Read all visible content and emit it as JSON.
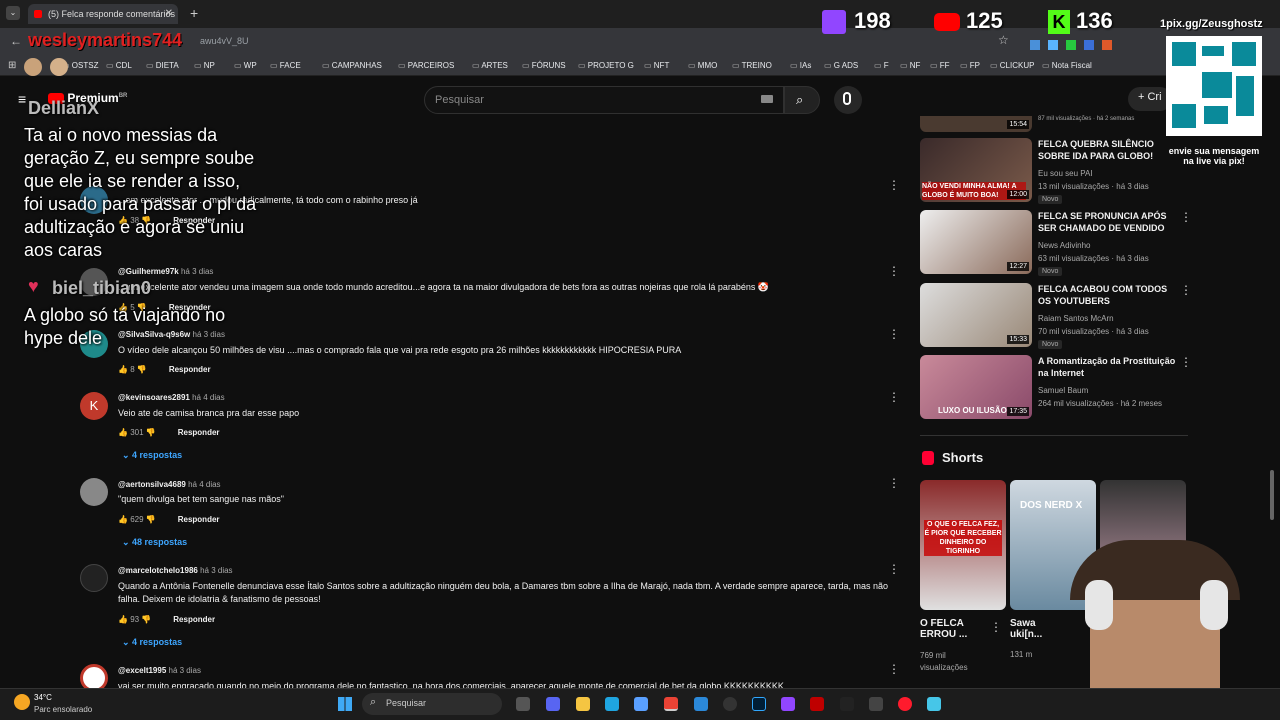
{
  "browser": {
    "tab_title": "(5) Felca responde comentários",
    "url": "awu4vV_8U",
    "bookmarks": [
      "OSTSZ",
      "CDL",
      "DIETA",
      "NP",
      "WP",
      "FACE",
      "CAMPANHAS",
      "PARCEIROS",
      "ARTES",
      "FÓRUNS",
      "PROJETO G",
      "NFT",
      "MMO",
      "TREINO",
      "IAs",
      "G ADS",
      "F",
      "NF",
      "FF",
      "FP",
      "CLICKUP",
      "Nota Fiscal"
    ]
  },
  "youtube": {
    "logo": "Premium",
    "logo_sup": "BR",
    "search_placeholder": "Pesquisar",
    "create_label": "Cri"
  },
  "stream_overlay": {
    "channel_name": "wesleymartins744",
    "chat_user_1": "DellianX",
    "chat_msg_1": "Ta ai o novo messias da geração Z, eu sempre soube que ele ia se render a isso, foi usado para passar o pl da adultização e agora se uniu aos caras",
    "chat_user_2": "biel_tibian0",
    "chat_msg_2": "A globo só tá viajando no hype dele",
    "twitch_count": "198",
    "youtube_count": "125",
    "kick_count": "136",
    "pix_url": "1pix.gg/Zeusghostz",
    "pix_msg": "envie sua mensagem na live via pix!"
  },
  "comments": [
    {
      "handle": "",
      "time": "",
      "text": "...em excelente ator ... mudou radicalmente, tá todo com o rabinho preso já",
      "likes": "38",
      "reply_label": "Responder"
    },
    {
      "handle": "@Guilherme97k",
      "time": "há 3 dias",
      "text": "...um excelente ator vendeu uma imagem sua onde todo mundo acreditou...e agora ta na maior divulgadora de bets fora as outras nojeiras que rola lá parabéns 🤡",
      "likes": "5",
      "reply_label": "Responder"
    },
    {
      "handle": "@SilvaSilva-q9s6w",
      "time": "há 3 dias",
      "text": "O vídeo dele alcançou 50 milhões de visu ....mas o comprado fala que vai pra rede esgoto pra 26 milhões kkkkkkkkkkkk HIPOCRESIA PURA",
      "likes": "8",
      "reply_label": "Responder"
    },
    {
      "handle": "@kevinsoares2891",
      "time": "há 4 dias",
      "text": "Veio ate de camisa branca pra dar esse papo",
      "likes": "301",
      "reply_label": "Responder",
      "replies": "4 respostas"
    },
    {
      "handle": "@aertonsilva4689",
      "time": "há 4 dias",
      "text": "\"quem divulga bet tem sangue nas mãos\"",
      "likes": "629",
      "reply_label": "Responder",
      "replies": "48 respostas"
    },
    {
      "handle": "@marcelotchelo1986",
      "time": "há 3 dias",
      "text": "Quando a Antônia Fontenelle denunciava esse Ítalo Santos sobre a adultização ninguém deu bola, a Damares tbm sobre a Ilha de Marajó, nada tbm. A verdade sempre aparece, tarda, mas não falha. Deixem de idolatria & fanatismo de pessoas!",
      "likes": "93",
      "reply_label": "Responder",
      "replies": "4 respostas"
    },
    {
      "handle": "@excelt1995",
      "time": "há 3 dias",
      "text": "vai ser muito engracado quando no meio do programa dele no fantastico, na hora dos comerciais, aparecer aquele monte de comercial de bet da globo KKKKKKKKKK"
    }
  ],
  "sidebar_videos": [
    {
      "title": "",
      "channel": "",
      "meta": "87 mil visualizações · há 2 semanas",
      "duration": "15:54"
    },
    {
      "title": "FELCA QUEBRA SILÊNCIO SOBRE IDA PARA GLOBO!",
      "channel": "Eu sou seu PAI",
      "meta": "13 mil visualizações · há 3 dias",
      "duration": "12:00",
      "badge": "Novo",
      "thumb_text": "NÃO VENDI MINHA ALMA! A GLOBO É MUITO BOA!"
    },
    {
      "title": "FELCA SE PRONUNCIA APÓS SER CHAMADO DE VENDIDO",
      "channel": "News Adivinho",
      "meta": "63 mil visualizações · há 3 dias",
      "duration": "12:27",
      "badge": "Novo"
    },
    {
      "title": "FELCA ACABOU COM TODOS OS YOUTUBERS",
      "channel": "Raiam Santos McArn",
      "meta": "70 mil visualizações · há 3 dias",
      "duration": "15:33",
      "badge": "Novo"
    },
    {
      "title": "A Romantização da Prostituição na Internet",
      "channel": "Samuel Baum",
      "meta": "264 mil visualizações · há 2 meses",
      "duration": "17:35",
      "thumb_text": "LUXO OU ILUSÃO"
    }
  ],
  "shorts": {
    "heading": "Shorts",
    "items": [
      {
        "title": "O FELCA ERROU ...",
        "views": "769 mil visualizações",
        "thumb_text": "O QUE O FELCA FEZ, É PIOR QUE RECEBER DINHEIRO DO TIGRINHO"
      },
      {
        "title": "Sawa uki[n...",
        "views": "131 m",
        "thumb_text": "DOS NERD X"
      },
      {
        "title": "",
        "views": "",
        "thumb_text": ""
      }
    ]
  },
  "taskbar": {
    "temperature": "34°C",
    "weather": "Parc ensolarado",
    "search_label": "Pesquisar"
  }
}
